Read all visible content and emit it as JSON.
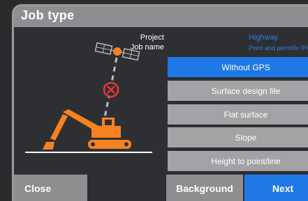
{
  "window": {
    "title": "Job type"
  },
  "info": {
    "project_label": "Project",
    "project_value": "Highway",
    "job_name_label": "Job name",
    "job_name_value": "Point and permille 0%"
  },
  "options": [
    {
      "label": "Without GPS",
      "selected": true
    },
    {
      "label": "Surface design file",
      "selected": false
    },
    {
      "label": "Flat surface",
      "selected": false
    },
    {
      "label": "Slope",
      "selected": false
    },
    {
      "label": "Height to point/line",
      "selected": false
    }
  ],
  "footer": {
    "close_label": "Close",
    "background_label": "Background",
    "next_label": "Next"
  },
  "colors": {
    "accent": "#1e78e6",
    "button_grey": "#a3a3a5",
    "excavator": "#f58220",
    "no_signal": "#e53935"
  },
  "illustration": {
    "icons": [
      "satellite-icon",
      "no-signal-icon",
      "excavator-icon"
    ]
  }
}
